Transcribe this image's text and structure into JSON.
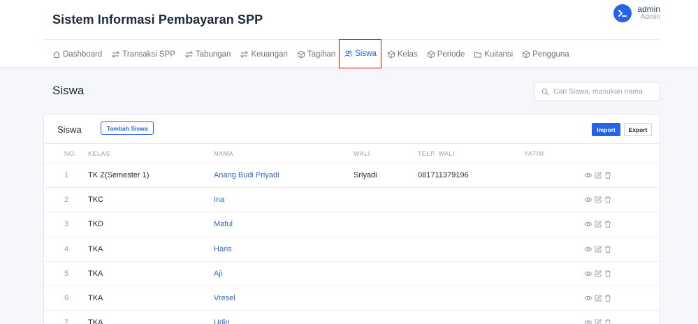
{
  "header": {
    "app_title": "Sistem Informasi Pembayaran SPP",
    "user_name": "admin",
    "user_role": "Admin"
  },
  "nav": [
    {
      "label": "Dashboard",
      "icon": "home-icon"
    },
    {
      "label": "Transaksi SPP",
      "icon": "exchange-icon"
    },
    {
      "label": "Tabungan",
      "icon": "exchange-icon"
    },
    {
      "label": "Keuangan",
      "icon": "exchange-icon"
    },
    {
      "label": "Tagihan",
      "icon": "box-icon"
    },
    {
      "label": "Siswa",
      "icon": "users-icon",
      "active": true
    },
    {
      "label": "Kelas",
      "icon": "box-icon"
    },
    {
      "label": "Periode",
      "icon": "box-icon"
    },
    {
      "label": "Kuitansi",
      "icon": "folder-icon"
    },
    {
      "label": "Pengguna",
      "icon": "box-icon"
    }
  ],
  "page": {
    "title": "Siswa",
    "search_placeholder": "Cari Siswa, masukan nama"
  },
  "card": {
    "title": "Siswa",
    "add_button": "Tambah Siswa",
    "import_button": "Import",
    "export_button": "Export"
  },
  "table": {
    "columns": [
      "NO.",
      "KELAS",
      "NAMA",
      "WALI",
      "TELP. WALI",
      "YATIM"
    ],
    "rows": [
      {
        "no": "1",
        "kelas": "TK Z(Semester 1)",
        "nama": "Anang Budi Priyadi",
        "wali": "Sriyadi",
        "telp": "081711379196",
        "yatim": ""
      },
      {
        "no": "2",
        "kelas": "TKC",
        "nama": "Ina",
        "wali": "",
        "telp": "",
        "yatim": ""
      },
      {
        "no": "3",
        "kelas": "TKD",
        "nama": "Maful",
        "wali": "",
        "telp": "",
        "yatim": ""
      },
      {
        "no": "4",
        "kelas": "TKA",
        "nama": "Haris",
        "wali": "",
        "telp": "",
        "yatim": ""
      },
      {
        "no": "5",
        "kelas": "TKA",
        "nama": "Aji",
        "wali": "",
        "telp": "",
        "yatim": ""
      },
      {
        "no": "6",
        "kelas": "TKA",
        "nama": "Vresel",
        "wali": "",
        "telp": "",
        "yatim": ""
      },
      {
        "no": "7",
        "kelas": "TKA",
        "nama": "Udin",
        "wali": "",
        "telp": "",
        "yatim": ""
      }
    ],
    "row_actions": [
      "eye-icon",
      "edit-icon",
      "trash-icon"
    ]
  },
  "colors": {
    "accent": "#2563eb",
    "highlight_box": "#e11d1d",
    "link": "#2f66d0"
  }
}
